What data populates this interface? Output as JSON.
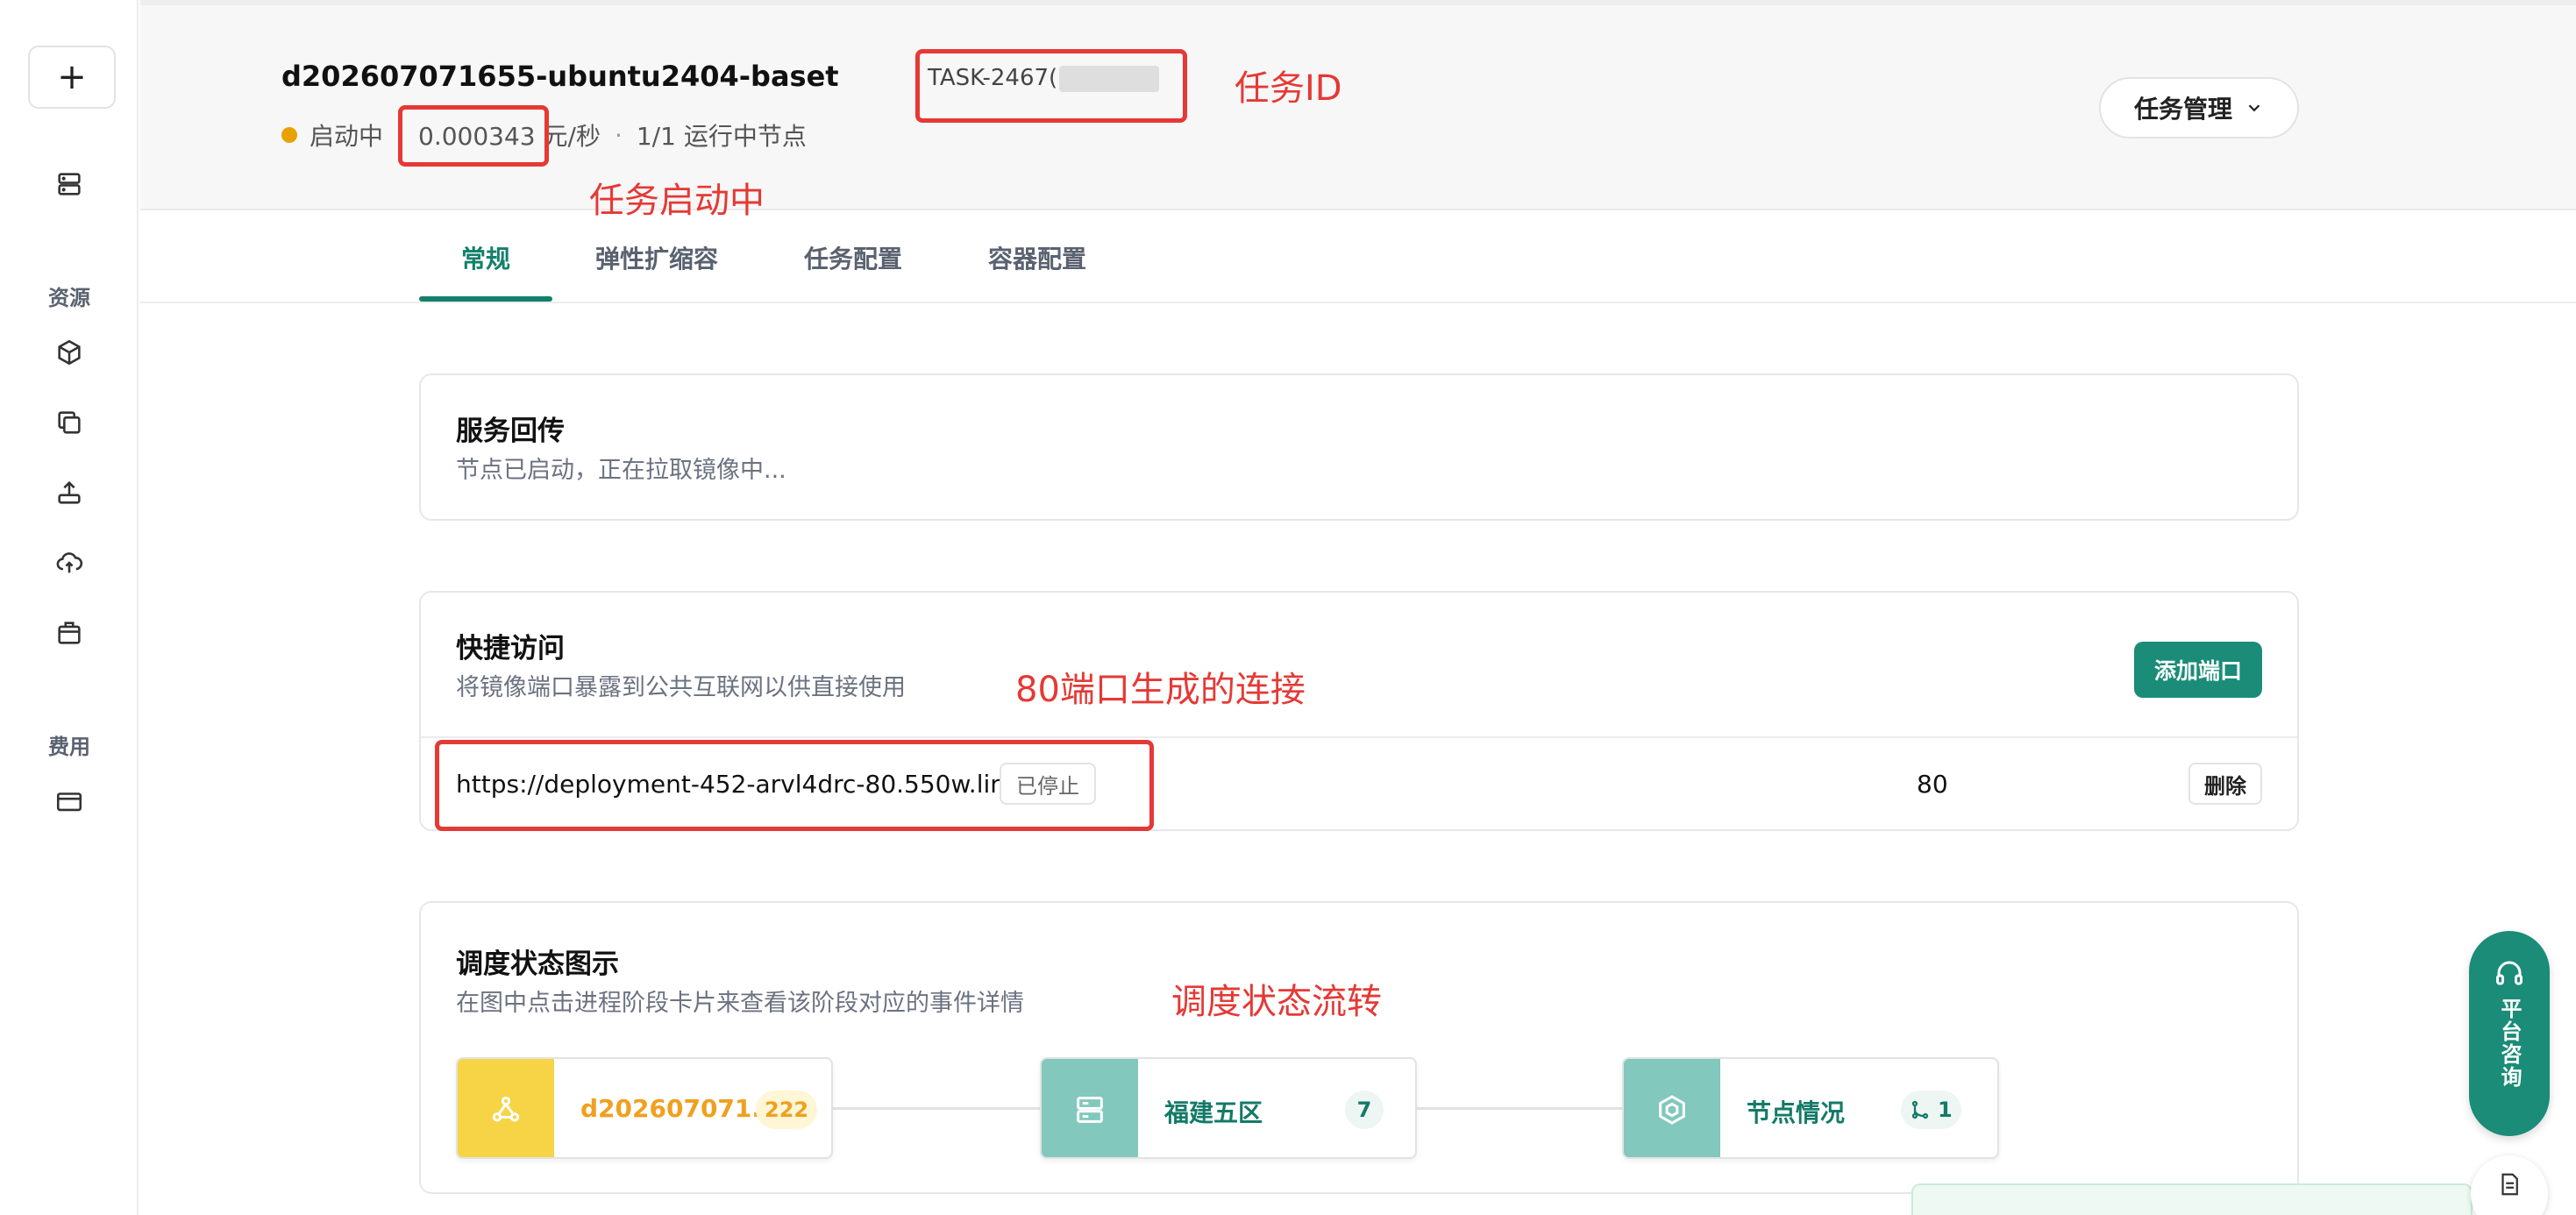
{
  "sidebar": {
    "add_label": "+",
    "section_resources": "资源",
    "section_billing": "费用",
    "icons": [
      "server-icon",
      "cube-icon",
      "copy-icon",
      "upload-icon",
      "cloud-icon",
      "box-icon",
      "card-icon"
    ]
  },
  "header": {
    "title": "d202607071655-ubuntu2404-baset",
    "task_id": "TASK-2467(",
    "status": "启动中",
    "price": "0.000343 元/秒",
    "separator": "·",
    "nodes": "1/1 运行中节点",
    "manage_button": "任务管理"
  },
  "tabs": [
    {
      "label": "常规",
      "active": true
    },
    {
      "label": "弹性扩缩容",
      "active": false
    },
    {
      "label": "任务配置",
      "active": false
    },
    {
      "label": "容器配置",
      "active": false
    }
  ],
  "service_card": {
    "title": "服务回传",
    "desc": "节点已启动，正在拉取镜像中..."
  },
  "quick_access": {
    "title": "快捷访问",
    "desc": "将镜像端口暴露到公共互联网以供直接使用",
    "add_button": "添加端口",
    "rows": [
      {
        "url": "https://deployment-452-arvl4drc-80.550w.link",
        "status": "已停止",
        "port": "80",
        "delete_label": "删除"
      }
    ]
  },
  "schedule": {
    "title": "调度状态图示",
    "desc": "在图中点击进程阶段卡片来查看该阶段对应的事件详情",
    "steps": [
      {
        "label": "d202607071...",
        "count": "222",
        "icon": "nodes-icon",
        "color": "#f6d445",
        "text_color": "#f0a01f"
      },
      {
        "label": "福建五区",
        "count": "7",
        "icon": "server-icon",
        "color": "#82c8bc",
        "text_color": "#147a68"
      },
      {
        "label": "节点情况",
        "count": "1",
        "icon": "cube-outline-icon",
        "color": "#82c8bc",
        "text_color": "#147a68"
      }
    ]
  },
  "annotations": {
    "task_id": "任务ID",
    "starting": "任务启动中",
    "link": "80端口生成的连接",
    "flow": "调度状态流转"
  },
  "consult": {
    "label": "平台咨询"
  },
  "colors": {
    "accent": "#13806b",
    "button": "#1a8c78",
    "status_dot": "#e8a200",
    "annotation": "#e53935"
  }
}
